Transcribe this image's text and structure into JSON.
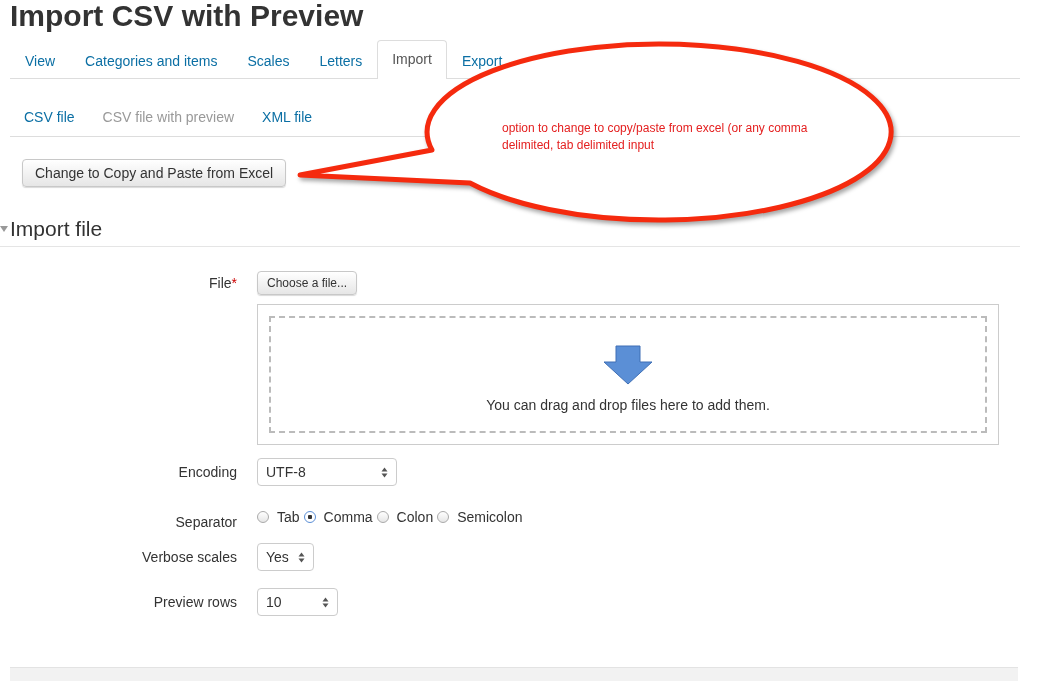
{
  "page_title": "Import CSV with Preview",
  "tabs": [
    {
      "label": "View",
      "selected": false
    },
    {
      "label": "Categories and items",
      "selected": false
    },
    {
      "label": "Scales",
      "selected": false
    },
    {
      "label": "Letters",
      "selected": false
    },
    {
      "label": "Import",
      "selected": true
    },
    {
      "label": "Export",
      "selected": false
    }
  ],
  "subtabs": [
    {
      "label": "CSV file",
      "selected": false
    },
    {
      "label": "CSV file with preview",
      "selected": true
    },
    {
      "label": "XML file",
      "selected": false
    }
  ],
  "switch_button": "Change to Copy and Paste from Excel",
  "section": {
    "title": "Import file",
    "expanded": true
  },
  "form": {
    "file": {
      "label": "File",
      "required_mark": "*",
      "button": "Choose a file...",
      "drop_hint": "You can drag and drop files here to add them."
    },
    "encoding": {
      "label": "Encoding",
      "value": "UTF-8"
    },
    "separator": {
      "label": "Separator",
      "options": [
        {
          "label": "Tab",
          "selected": false
        },
        {
          "label": "Comma",
          "selected": true
        },
        {
          "label": "Colon",
          "selected": false
        },
        {
          "label": "Semicolon",
          "selected": false
        }
      ]
    },
    "verbose_scales": {
      "label": "Verbose scales",
      "value": "Yes"
    },
    "preview_rows": {
      "label": "Preview rows",
      "value": "10"
    }
  },
  "callout": {
    "text": "option to change to copy/paste from excel (or any comma delimited, tab delimited input"
  }
}
